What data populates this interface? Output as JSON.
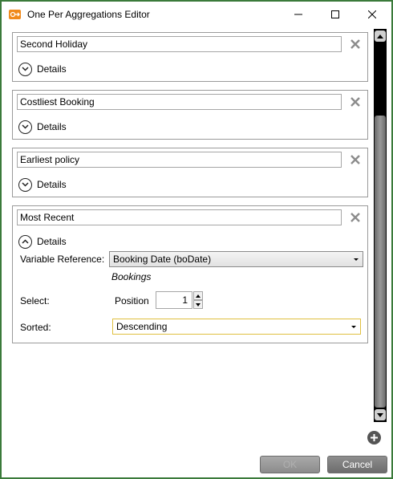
{
  "window": {
    "title": "One Per Aggregations Editor"
  },
  "details_label": "Details",
  "aggregations": [
    {
      "name": "Second Holiday"
    },
    {
      "name": "Costliest Booking"
    },
    {
      "name": "Earliest policy"
    },
    {
      "name": "Most Recent",
      "details": {
        "variable_reference_label": "Variable Reference:",
        "variable_reference_value": "Booking Date (boDate)",
        "table_name": "Bookings",
        "select_label": "Select:",
        "position_label": "Position",
        "position_value": "1",
        "sorted_label": "Sorted:",
        "sorted_value": "Descending"
      }
    }
  ],
  "buttons": {
    "ok_label": "OK",
    "cancel_label": "Cancel"
  },
  "colors": {
    "window_border": "#3a7a3a",
    "app_icon": "#f08a1c",
    "sorted_border": "#e0c040"
  }
}
